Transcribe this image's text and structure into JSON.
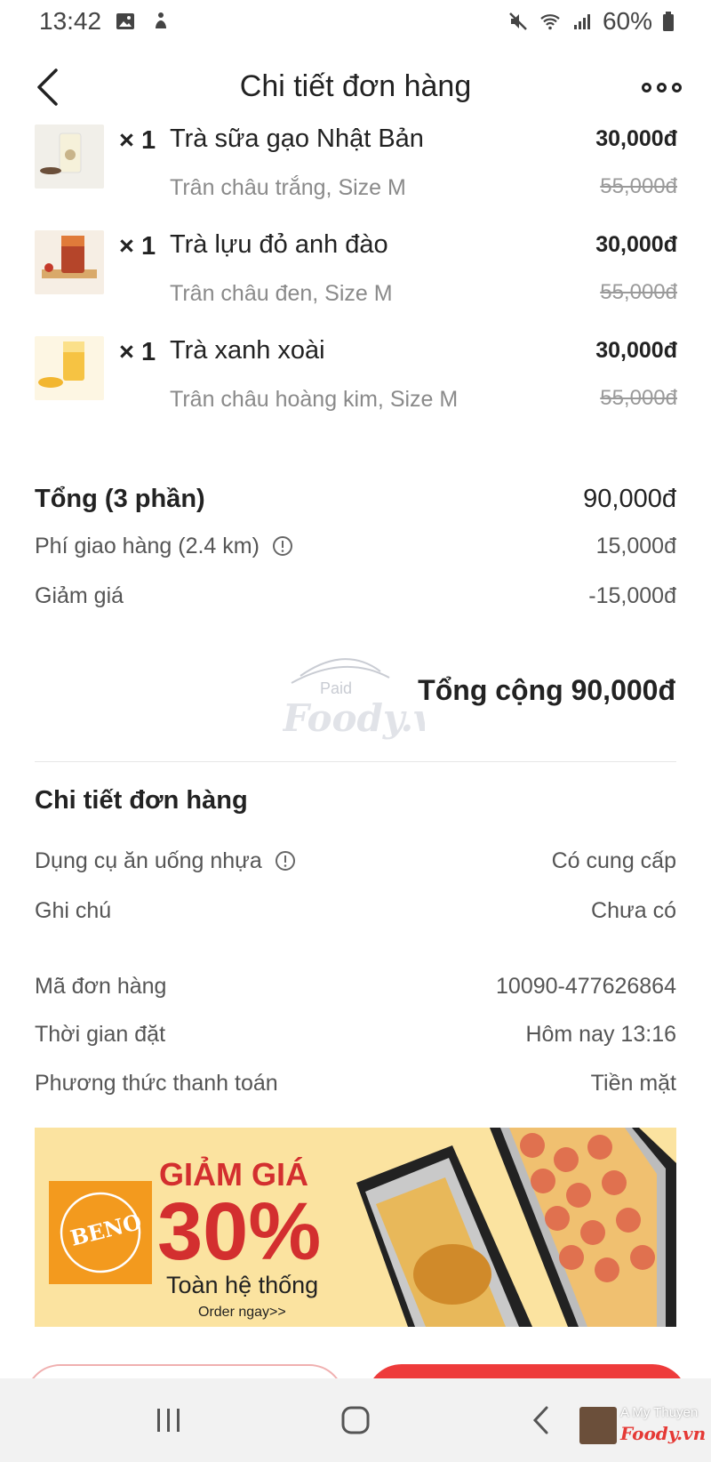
{
  "status_bar": {
    "time": "13:42",
    "battery": "60%"
  },
  "header": {
    "title": "Chi tiết đơn hàng"
  },
  "items": [
    {
      "qty": "× 1",
      "name": "Trà sữa gạo Nhật Bản",
      "options": "Trân châu trắng, Size M",
      "price": "30,000đ",
      "old_price": "55,000đ"
    },
    {
      "qty": "× 1",
      "name": "Trà lựu đỏ anh đào",
      "options": "Trân châu đen, Size M",
      "price": "30,000đ",
      "old_price": "55,000đ"
    },
    {
      "qty": "× 1",
      "name": "Trà xanh xoài",
      "options": "Trân châu hoàng kim, Size M",
      "price": "30,000đ",
      "old_price": "55,000đ"
    }
  ],
  "summary": {
    "subtotal_label": "Tổng (3 phần)",
    "subtotal_value": "90,000đ",
    "shipping_label": "Phí giao hàng (2.4 km)",
    "shipping_value": "15,000đ",
    "discount_label": "Giảm giá",
    "discount_value": "-15,000đ",
    "grand_total": "Tổng cộng 90,000đ",
    "stamp_text": "Paid"
  },
  "details": {
    "title": "Chi tiết đơn hàng",
    "utensils_label": "Dụng cụ ăn uống nhựa",
    "utensils_value": "Có cung cấp",
    "note_label": "Ghi chú",
    "note_value": "Chưa có",
    "order_id_label": "Mã đơn hàng",
    "order_id_value": "10090-477626864",
    "time_label": "Thời gian đặt",
    "time_value": "Hôm nay 13:16",
    "payment_label": "Phương thức thanh toán",
    "payment_value": "Tiền mặt"
  },
  "banner": {
    "logo": "BENO",
    "headline": "GIẢM GIÁ",
    "percent": "30%",
    "subline": "Toàn hệ thống",
    "cta": "Order ngay>>"
  },
  "watermark": {
    "name": "A My Thuyen",
    "brand": "Foody.vn"
  },
  "colors": {
    "accent": "#ee3b3b",
    "banner_bg": "#fbe3a0",
    "banner_red": "#d32f2f",
    "beno_orange": "#f39a1e"
  }
}
